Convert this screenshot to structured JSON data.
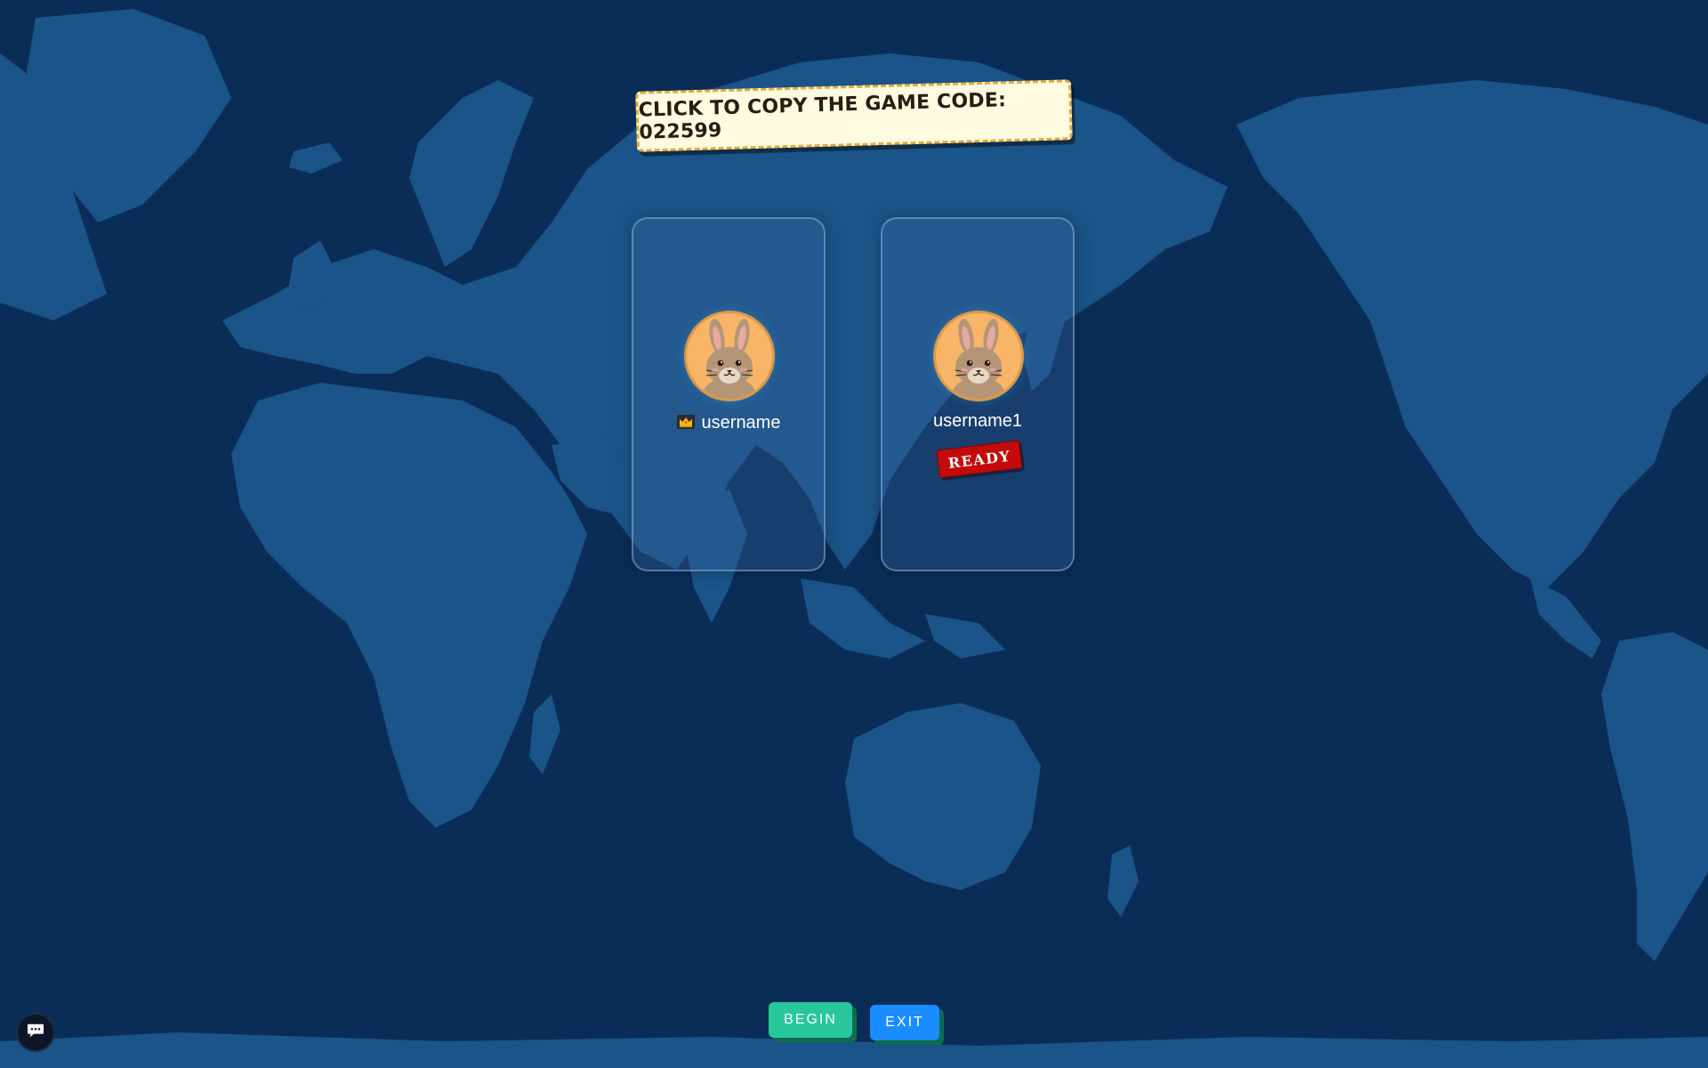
{
  "code_banner": {
    "text": "Click to copy the Game Code: 022599"
  },
  "players": [
    {
      "name": "username",
      "is_host": true,
      "avatar_icon": "bunny-icon",
      "status": ""
    },
    {
      "name": "username1",
      "is_host": false,
      "avatar_icon": "bunny-icon",
      "status": "READY"
    }
  ],
  "buttons": {
    "begin_label": "BEGIN",
    "exit_label": "EXIT"
  },
  "chat": {
    "icon": "chat-bubble-icon"
  },
  "colors": {
    "background": "#0a2d57",
    "land": "#1a5488",
    "banner_bg": "#fffbe0",
    "banner_border": "#e3a93b",
    "begin_button": "#27c79b",
    "exit_button": "#1a8cff",
    "ready_badge": "#c30b0b",
    "avatar_bg": "#f8b567"
  }
}
